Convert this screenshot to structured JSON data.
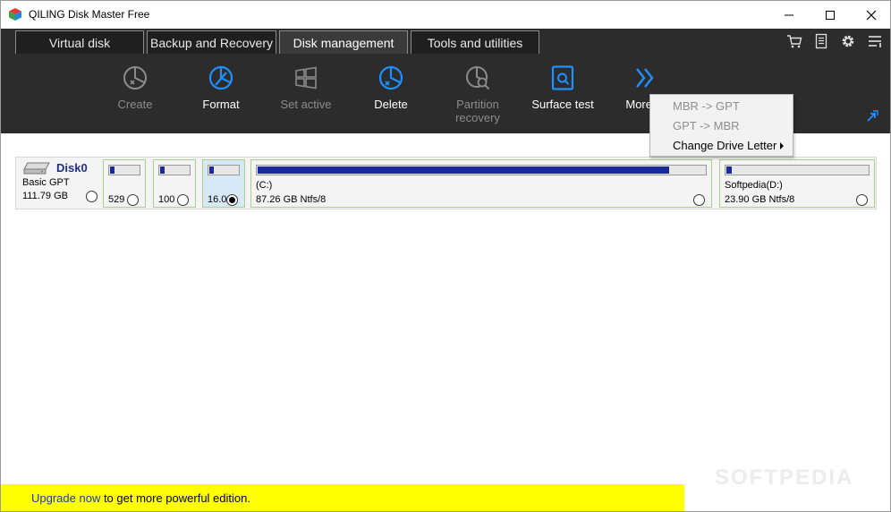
{
  "window": {
    "title": "QILING Disk Master Free"
  },
  "tabs": [
    {
      "label": "Virtual disk"
    },
    {
      "label": "Backup and Recovery"
    },
    {
      "label": "Disk management"
    },
    {
      "label": "Tools and utilities"
    }
  ],
  "active_tab": "Disk management",
  "toolbar": {
    "create": "Create",
    "format": "Format",
    "set_active": "Set active",
    "delete": "Delete",
    "partition_recovery": "Partition recovery",
    "surface_test": "Surface test",
    "more": "More"
  },
  "menu": {
    "mbr_to_gpt": "MBR -> GPT",
    "gpt_to_mbr": "GPT -> MBR",
    "change_drive_letter": "Change Drive Letter"
  },
  "disk": {
    "name": "Disk0",
    "type": "Basic GPT",
    "size": "111.79 GB",
    "partitions": [
      {
        "size_text": "529",
        "usage": 0.15
      },
      {
        "size_text": "100",
        "usage": 0.15
      },
      {
        "size_text": "16.0",
        "usage": 0.15,
        "selected": true
      },
      {
        "label": "(C:)",
        "size_text": "87.26 GB Ntfs/8",
        "usage": 0.92
      },
      {
        "label": "Softpedia(D:)",
        "size_text": "23.90 GB Ntfs/8",
        "usage": 0.04
      }
    ]
  },
  "upgrade": {
    "link": "Upgrade now",
    "text": " to get more powerful edition."
  },
  "watermark": "SOFTPEDIA",
  "colors": {
    "toolbar_bg": "#2c2c2c",
    "accent_blue": "#1e90ff",
    "usage_bar": "#1a2a9a",
    "banner": "#ffff00"
  }
}
